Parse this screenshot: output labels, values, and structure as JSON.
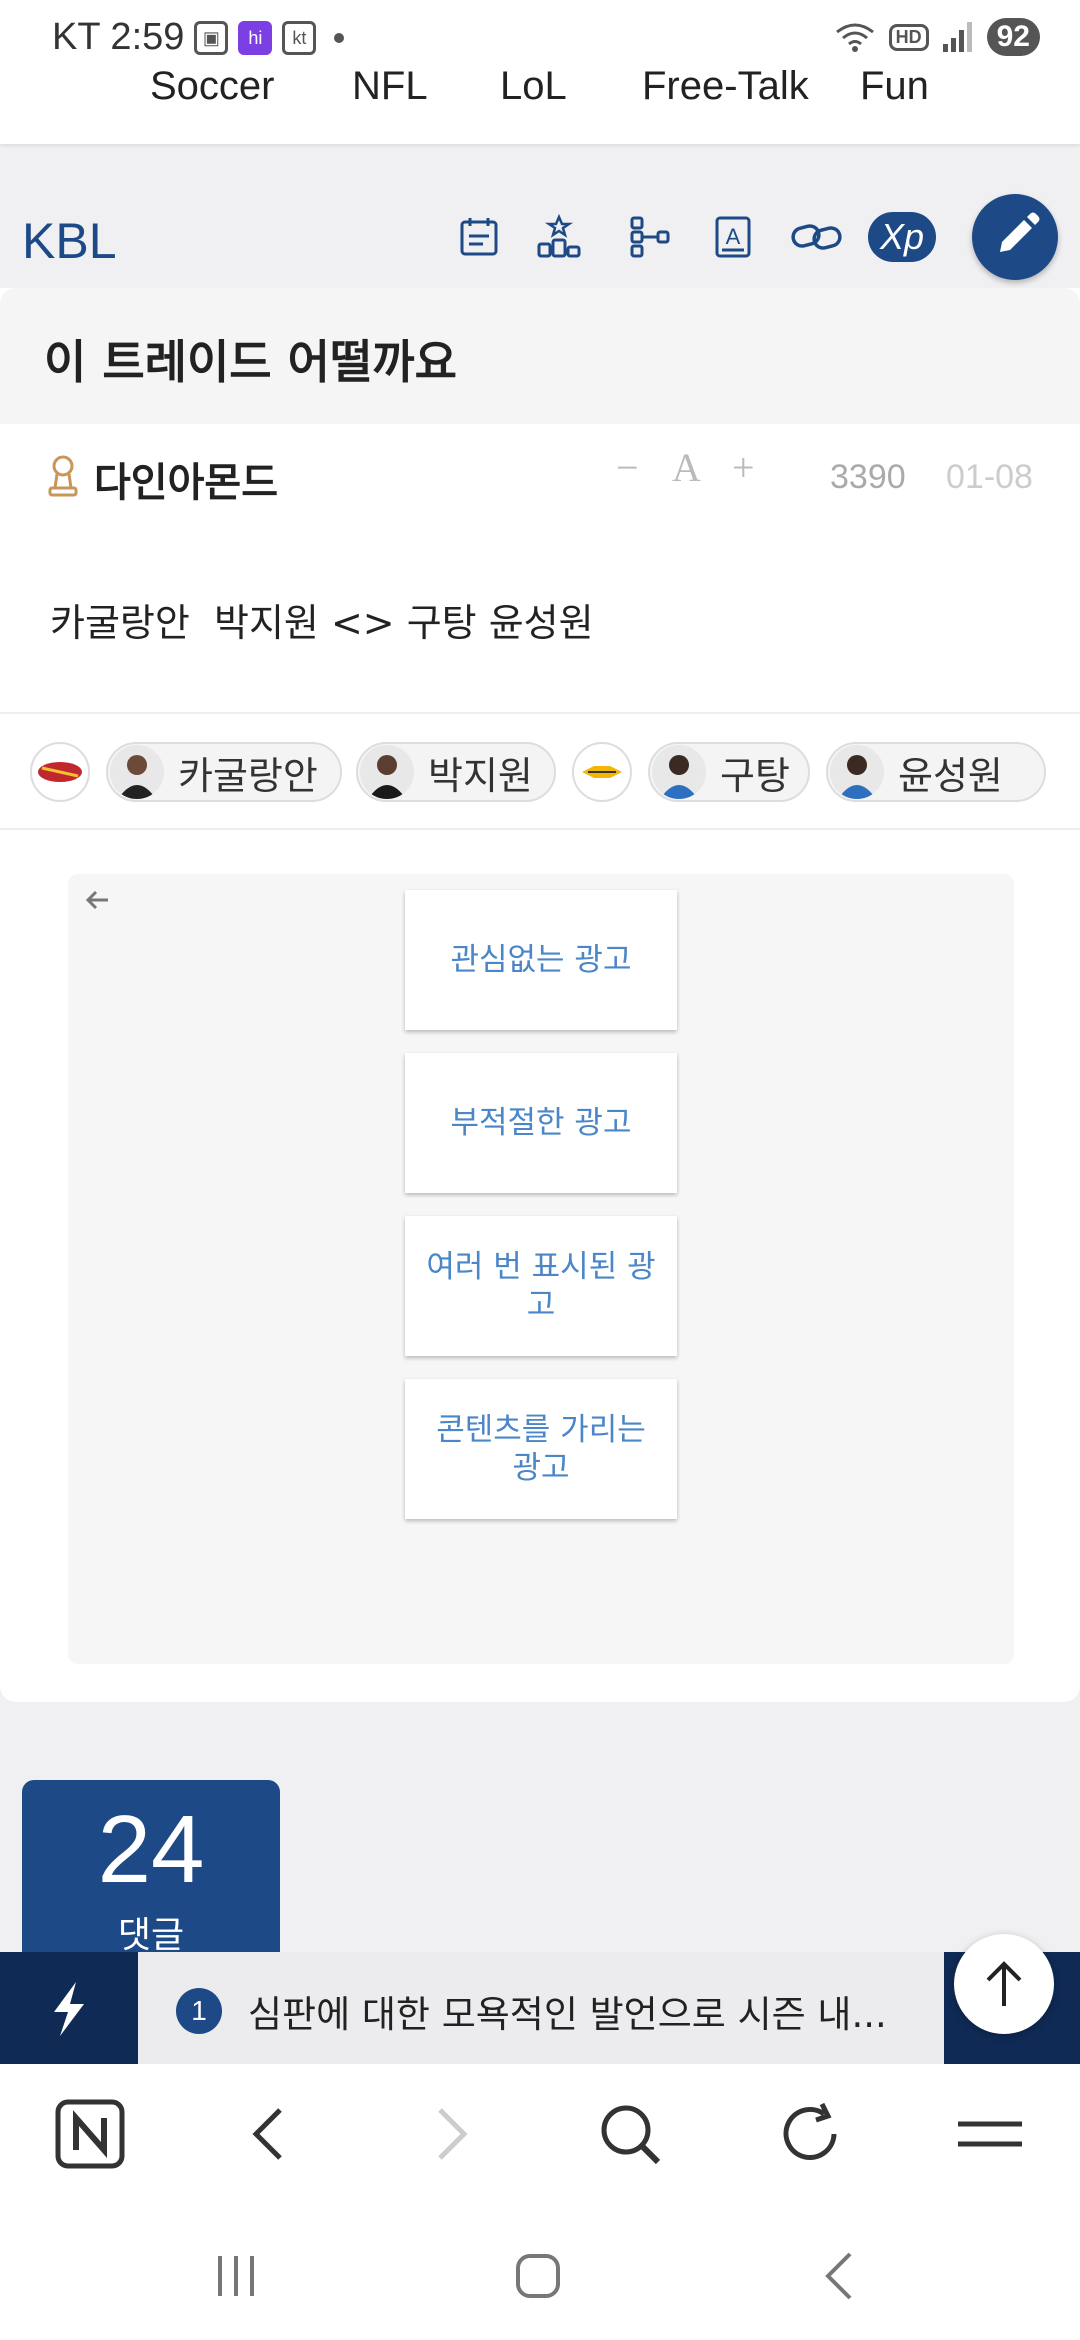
{
  "status_bar": {
    "carrier_time": "KT 2:59",
    "icon_app": "hi",
    "icon_kt": "kt",
    "network": "HD",
    "battery": "92"
  },
  "top_nav": {
    "items": [
      "Soccer",
      "NFL",
      "LoL",
      "Free-Talk",
      "Fun"
    ]
  },
  "board": {
    "name": "KBL",
    "toolbar_icons": [
      "calendar-icon",
      "ranking-icon",
      "bracket-icon",
      "dictionary-icon",
      "link-icon"
    ],
    "xp_label": "Xp"
  },
  "post": {
    "title": "이 트레이드 어떨까요",
    "author": "다인아몬드",
    "font_minus": "−",
    "font_label": "A",
    "font_plus": "+",
    "views": "3390",
    "date": "01-08",
    "body": "카굴랑안  박지원 <> 구탕 윤성원",
    "tags": [
      "카굴랑안",
      "박지원",
      "구탕",
      "윤성원"
    ]
  },
  "ad_feedback": {
    "options": [
      "관심없는 광고",
      "부적절한 광고",
      "여러 번 표시된 광고",
      "콘텐츠를 가리는 광고"
    ]
  },
  "comments": {
    "count": "24",
    "label": "댓글"
  },
  "ticker": {
    "rank": "1",
    "headline": "심판에 대한 모욕적인 발언으로 시즌 내..."
  },
  "colors": {
    "brand": "#1d4a86",
    "ticker_bg": "#0f2a55",
    "ad_text": "#4a86c8"
  }
}
